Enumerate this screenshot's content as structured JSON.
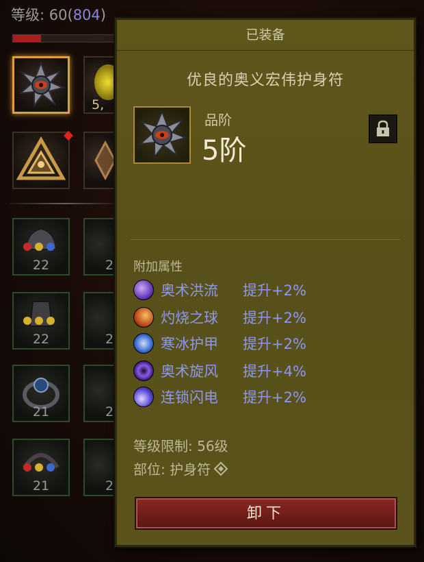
{
  "status": {
    "level_label": "等级: 60",
    "paragon_open": "(",
    "paragon": "804",
    "paragon_close": ")",
    "xp_progress": 0.27
  },
  "inventory": {
    "slot_partial_text": "5,",
    "gem_counts": [
      "22",
      "22",
      "21",
      "21"
    ],
    "partial_counts": [
      "2",
      "2",
      "2",
      "2"
    ]
  },
  "tooltip": {
    "header": "已装备",
    "item_name": "优良的奥义宏伟护身符",
    "grade_label": "品阶",
    "grade_value": "5阶",
    "attributes_title": "附加属性",
    "attributes": [
      {
        "skill": "奥术洪流",
        "bonus": "提升+2%",
        "icon": "arcane-torrent-icon",
        "color": "#7a4ad0"
      },
      {
        "skill": "灼烧之球",
        "bonus": "提升+2%",
        "icon": "meteor-icon",
        "color": "#c85a20"
      },
      {
        "skill": "寒冰护甲",
        "bonus": "提升+2%",
        "icon": "frost-armor-icon",
        "color": "#3a6ad0"
      },
      {
        "skill": "奥术旋风",
        "bonus": "提升+4%",
        "icon": "arcane-vortex-icon",
        "color": "#6a3ac8"
      },
      {
        "skill": "连锁闪电",
        "bonus": "提升+2%",
        "icon": "chain-lightning-icon",
        "color": "#4a4ad8"
      }
    ],
    "level_req": "等级限制: 56级",
    "slot_text": "部位: 护身符",
    "unequip_button": "卸下"
  }
}
